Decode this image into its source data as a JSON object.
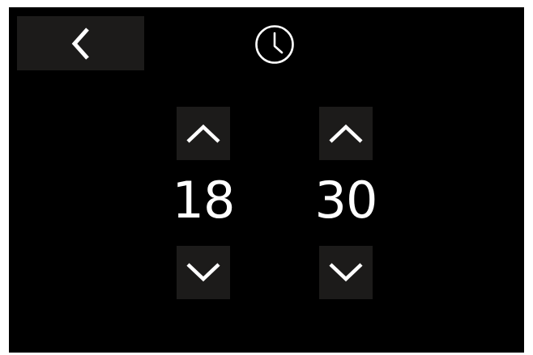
{
  "colors": {
    "background": "#000000",
    "button_background": "#1c1b1a",
    "foreground": "#ffffff"
  },
  "header": {
    "back_icon": "chevron-left-icon",
    "title_icon": "clock-icon"
  },
  "time_picker": {
    "hours": {
      "value": "18",
      "increment_icon": "chevron-up-icon",
      "decrement_icon": "chevron-down-icon"
    },
    "minutes": {
      "value": "30",
      "increment_icon": "chevron-up-icon",
      "decrement_icon": "chevron-down-icon"
    }
  }
}
